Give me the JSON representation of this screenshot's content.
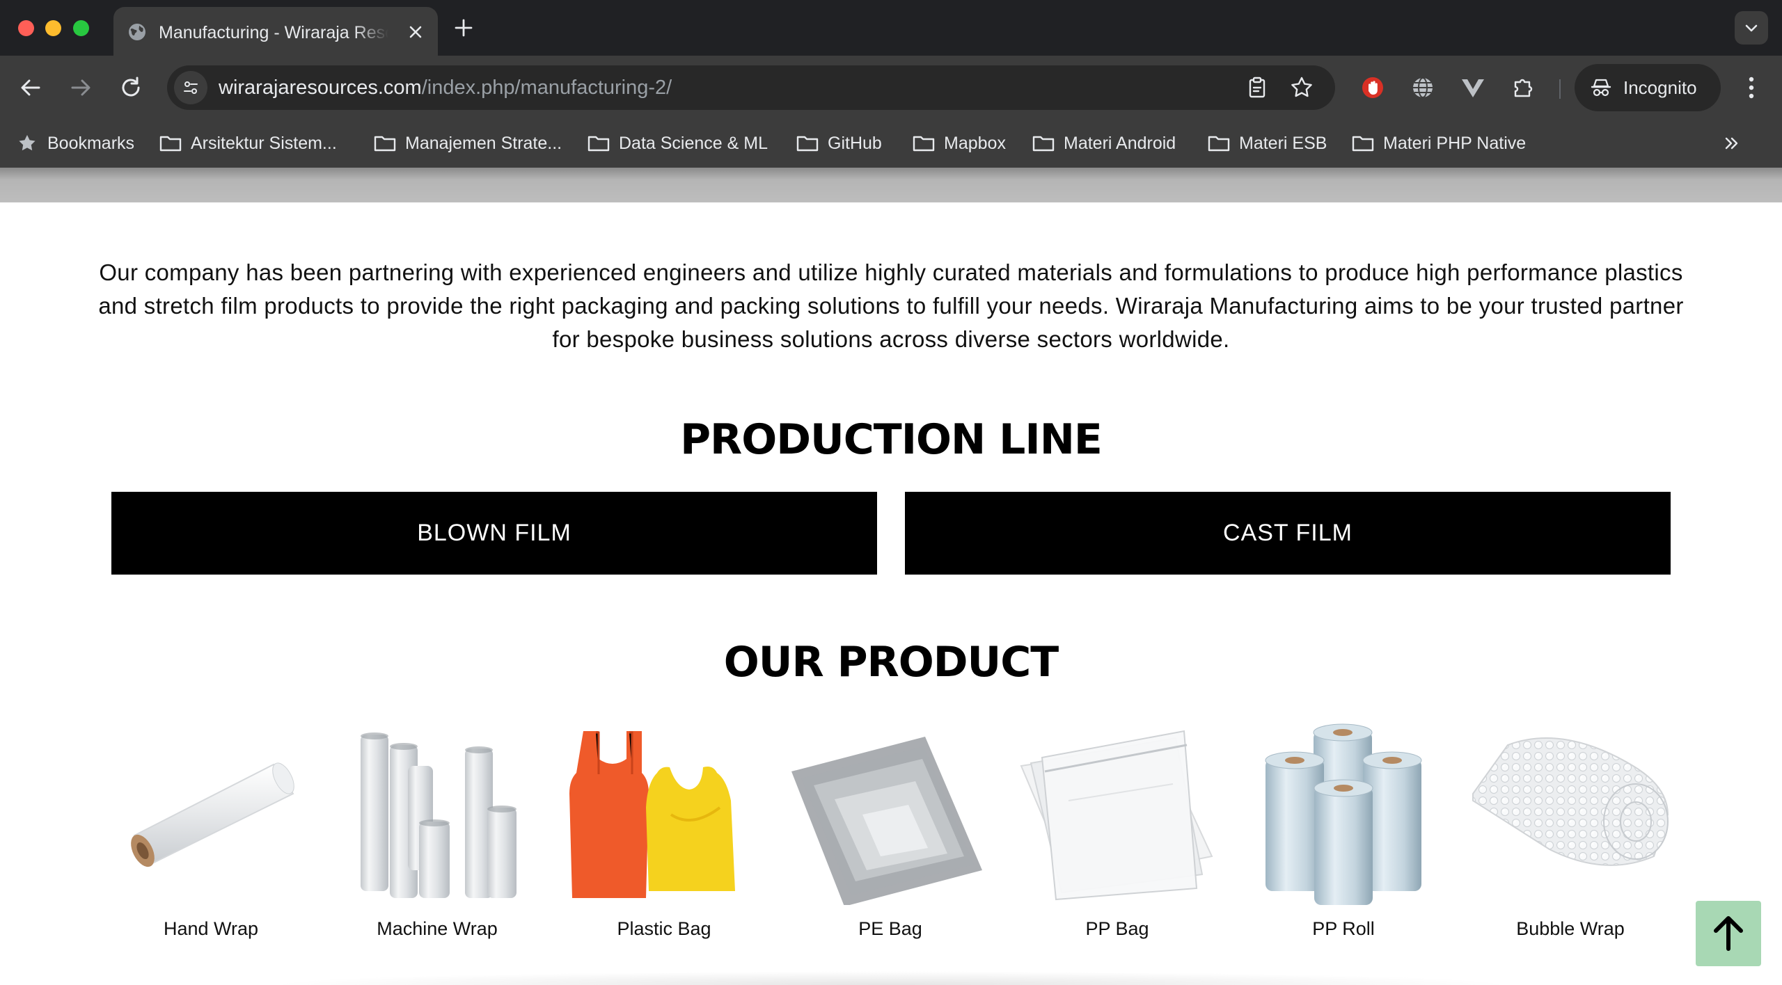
{
  "browser": {
    "tab": {
      "title": "Manufacturing - Wiraraja Resources"
    },
    "url": {
      "host": "wirarajaresources.com",
      "path": "/index.php/manufacturing-2/"
    },
    "profile_label": "Incognito",
    "bookmarks": [
      "Bookmarks",
      "Arsitektur Sistem...",
      "Manajemen Strate...",
      "Data Science & ML",
      "GitHub",
      "Mapbox",
      "Materi Android",
      "Materi ESB",
      "Materi PHP Native"
    ]
  },
  "page": {
    "intro": "Our company has been partnering with experienced engineers and utilize highly curated materials and formulations to produce high performance plastics and stretch film products to provide the right packaging and packing solutions to fulfill your needs. Wiraraja Manufacturing aims to be your trusted partner for bespoke business solutions across diverse sectors worldwide.",
    "production_line": {
      "title": "PRODUCTION LINE",
      "buttons": [
        "BLOWN FILM",
        "CAST FILM"
      ]
    },
    "our_product": {
      "title": "OUR PRODUCT",
      "items": [
        {
          "label": "Hand Wrap",
          "icon": "hand-wrap-image"
        },
        {
          "label": "Machine Wrap",
          "icon": "machine-wrap-image"
        },
        {
          "label": "Plastic Bag",
          "icon": "plastic-bag-image"
        },
        {
          "label": "PE Bag",
          "icon": "pe-bag-image"
        },
        {
          "label": "PP Bag",
          "icon": "pp-bag-image"
        },
        {
          "label": "PP Roll",
          "icon": "pp-roll-image"
        },
        {
          "label": "Bubble Wrap",
          "icon": "bubble-wrap-image"
        }
      ]
    },
    "back_to_top_icon": "arrow-up-icon",
    "colors": {
      "accent_button": "#a8d8b4",
      "production_button": "#000000"
    }
  }
}
